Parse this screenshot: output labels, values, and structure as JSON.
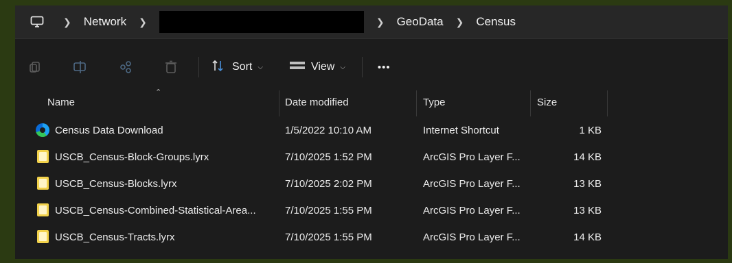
{
  "breadcrumb": {
    "items": [
      "Network",
      "GeoData",
      "Census"
    ]
  },
  "toolbar": {
    "sort_label": "Sort",
    "view_label": "View",
    "more_label": "•••"
  },
  "columns": {
    "name": "Name",
    "date": "Date modified",
    "type": "Type",
    "size": "Size"
  },
  "files": [
    {
      "name": "Census Data Download",
      "date": "1/5/2022 10:10 AM",
      "type": "Internet Shortcut",
      "size": "1 KB",
      "icon": "edge-shortcut-icon"
    },
    {
      "name": "USCB_Census-Block-Groups.lyrx",
      "date": "7/10/2025 1:52 PM",
      "type": "ArcGIS Pro Layer F...",
      "size": "14 KB",
      "icon": "layer-file-icon"
    },
    {
      "name": "USCB_Census-Blocks.lyrx",
      "date": "7/10/2025 2:02 PM",
      "type": "ArcGIS Pro Layer F...",
      "size": "13 KB",
      "icon": "layer-file-icon"
    },
    {
      "name": "USCB_Census-Combined-Statistical-Area...",
      "date": "7/10/2025 1:55 PM",
      "type": "ArcGIS Pro Layer F...",
      "size": "13 KB",
      "icon": "layer-file-icon"
    },
    {
      "name": "USCB_Census-Tracts.lyrx",
      "date": "7/10/2025 1:55 PM",
      "type": "ArcGIS Pro Layer F...",
      "size": "14 KB",
      "icon": "layer-file-icon"
    }
  ]
}
